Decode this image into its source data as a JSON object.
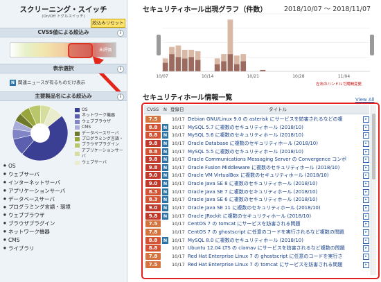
{
  "sidebar": {
    "title": "スクリーニング・スイッチ",
    "subtitle": "(On/Off トグルスイッチ)",
    "reset_label": "絞込みリセット",
    "cvss_header": "CVSS値による絞込み",
    "cvss_unset": "未評価",
    "display_header": "表示選択",
    "news_badge": "N",
    "news_label": "関連ニュースが有るものだけ表示",
    "product_header": "主要製品名による絞込み",
    "info_icon": "i",
    "legend": [
      {
        "label": "OS",
        "color": "#3b3f93"
      },
      {
        "label": "ネットワーク機器",
        "color": "#5b5fae"
      },
      {
        "label": "ウェブブラウザ",
        "color": "#8185c6"
      },
      {
        "label": "CMS",
        "color": "#a9abd8"
      },
      {
        "label": "データベースサーバ",
        "color": "#6e7a2a"
      },
      {
        "label": "プログラミング言語・",
        "color": "#97a53b"
      },
      {
        "label": "ブラウザプラグイン",
        "color": "#b9c76a"
      },
      {
        "label": "アプリケーションサーバ",
        "color": "#d6dd9e"
      },
      {
        "label": "ウェブサーバ",
        "color": "#e9edcd"
      }
    ],
    "products": [
      "OS",
      "ウェブサーバ",
      "インターネットサーバ",
      "アプリケーションサーバ",
      "データベースサーバ",
      "プログラミング言語・環境",
      "ウェブブラウザ",
      "ブラウザプラグイン",
      "ネットワーク機器",
      "CMS",
      "ライブラリ"
    ]
  },
  "chart": {
    "title": "セキュリティホール出現グラフ（件数）",
    "date_range": "2018/10/07 〜 2018/11/07",
    "drag_hint": "左右のハンドルで期間変更"
  },
  "chart_data": {
    "type": "bar",
    "categories": [
      "10/07",
      "10/08",
      "10/09",
      "10/10",
      "10/11",
      "10/12",
      "10/13",
      "10/14",
      "10/15",
      "10/16",
      "10/17",
      "10/18",
      "10/19",
      "10/20",
      "10/21",
      "10/22",
      "10/23",
      "10/24",
      "10/25",
      "10/26",
      "10/27",
      "10/28",
      "10/29",
      "10/30",
      "10/31",
      "11/01",
      "11/02",
      "11/03",
      "11/04",
      "11/05",
      "11/06",
      "11/07"
    ],
    "x_tick_labels": [
      "10/07",
      "10/14",
      "10/21",
      "10/28",
      "11/04"
    ],
    "series": [
      {
        "values": [
          6,
          12,
          10,
          9,
          10,
          8,
          0,
          0,
          5,
          7,
          12,
          5,
          7,
          0,
          0,
          1,
          0,
          0,
          0,
          0,
          0,
          0,
          0,
          0,
          0,
          0,
          0,
          0,
          0,
          0,
          0,
          0
        ],
        "color": "#9c6a5e"
      },
      {
        "values": [
          3,
          5,
          8,
          6,
          5,
          6,
          0,
          0,
          4,
          5,
          24,
          6,
          5,
          0,
          0,
          0,
          0,
          0,
          0,
          0,
          0,
          0,
          0,
          0,
          0,
          0,
          0,
          0,
          0,
          0,
          0,
          0
        ],
        "color": "#d9b9a6"
      }
    ],
    "ylim": [
      0,
      40
    ],
    "grid": true
  },
  "list": {
    "title": "セキュリティホール情報一覧",
    "view_all": "View All",
    "columns": {
      "cvss": "CVSS",
      "n": "N",
      "date": "登録日",
      "title": "タイトル"
    },
    "rows": [
      {
        "score": "7.5",
        "n": false,
        "date": "10/17",
        "title": "Debian GNU/Linux 9.0 の asterisk にサービスを妨害されるなどの複"
      },
      {
        "score": "8.8",
        "n": true,
        "date": "10/17",
        "title": "MySQL 5.7 に複数のセキュリティホール (2018/10)"
      },
      {
        "score": "8.8",
        "n": true,
        "date": "10/17",
        "title": "MySQL 5.6 に複数のセキュリティホール (2018/10)"
      },
      {
        "score": "9.8",
        "n": true,
        "date": "10/17",
        "title": "Oracle Database に複数のセキュリティホール (2018/10)"
      },
      {
        "score": "8.8",
        "n": true,
        "date": "10/17",
        "title": "MySQL 5.5 に複数のセキュリティホール (2018/10)"
      },
      {
        "score": "9.8",
        "n": true,
        "date": "10/17",
        "title": "Oracle Communications Messaging Server の Convergence コンポ"
      },
      {
        "score": "9.8",
        "n": true,
        "date": "10/17",
        "title": "Oracle Fusion Middleware に複数のセキュリティホール (2018/10)"
      },
      {
        "score": "9.0",
        "n": true,
        "date": "10/17",
        "title": "Oracle VM VirtualBox に複数のセキュリティホール (2018/10)"
      },
      {
        "score": "9.0",
        "n": true,
        "date": "10/17",
        "title": "Oracle Java SE 8 に複数のセキュリティホール (2018/10)"
      },
      {
        "score": "8.3",
        "n": true,
        "date": "10/17",
        "title": "Oracle Java SE 7 に複数のセキュリティホール (2018/10)"
      },
      {
        "score": "8.3",
        "n": true,
        "date": "10/17",
        "title": "Oracle Java SE 6 に複数のセキュリティホール (2018/10)"
      },
      {
        "score": "9.0",
        "n": true,
        "date": "10/17",
        "title": "Oracle Java SE 11 に複数のセキュリティホール (2018/10)"
      },
      {
        "score": "9.8",
        "n": true,
        "date": "10/17",
        "title": "Oracle JRockit に複数のセキュリティホール (2018/10)"
      },
      {
        "score": "7.5",
        "n": false,
        "date": "10/17",
        "title": "CentOS 7 の tomcat にサービスを妨害される問題"
      },
      {
        "score": "7.8",
        "n": false,
        "date": "10/17",
        "title": "CentOS 7 の ghostscript に任意のコードを実行されるなど複数の問題"
      },
      {
        "score": "8.8",
        "n": true,
        "date": "10/17",
        "title": "MySQL 8.0 に複数のセキュリティホール (2018/10)"
      },
      {
        "score": "8.8",
        "n": false,
        "date": "10/17",
        "title": "Ubuntu 12.04 LTS の clamav にサービスを妨害されるなど複数の問題"
      },
      {
        "score": "7.8",
        "n": false,
        "date": "10/17",
        "title": "Red Hat Enterprise Linux 7 の ghostscript に任意のコードを実行さ"
      },
      {
        "score": "7.5",
        "n": false,
        "date": "10/17",
        "title": "Red Hat Enterprise Linux 7 の tomcat にサービスを妨害される問題"
      }
    ]
  },
  "colors": {
    "score_high": "#c0392b",
    "score_mid": "#d35435",
    "score_low": "#d5743f",
    "n_badge": "#2b74a8",
    "highlight_red": "#e32020"
  }
}
